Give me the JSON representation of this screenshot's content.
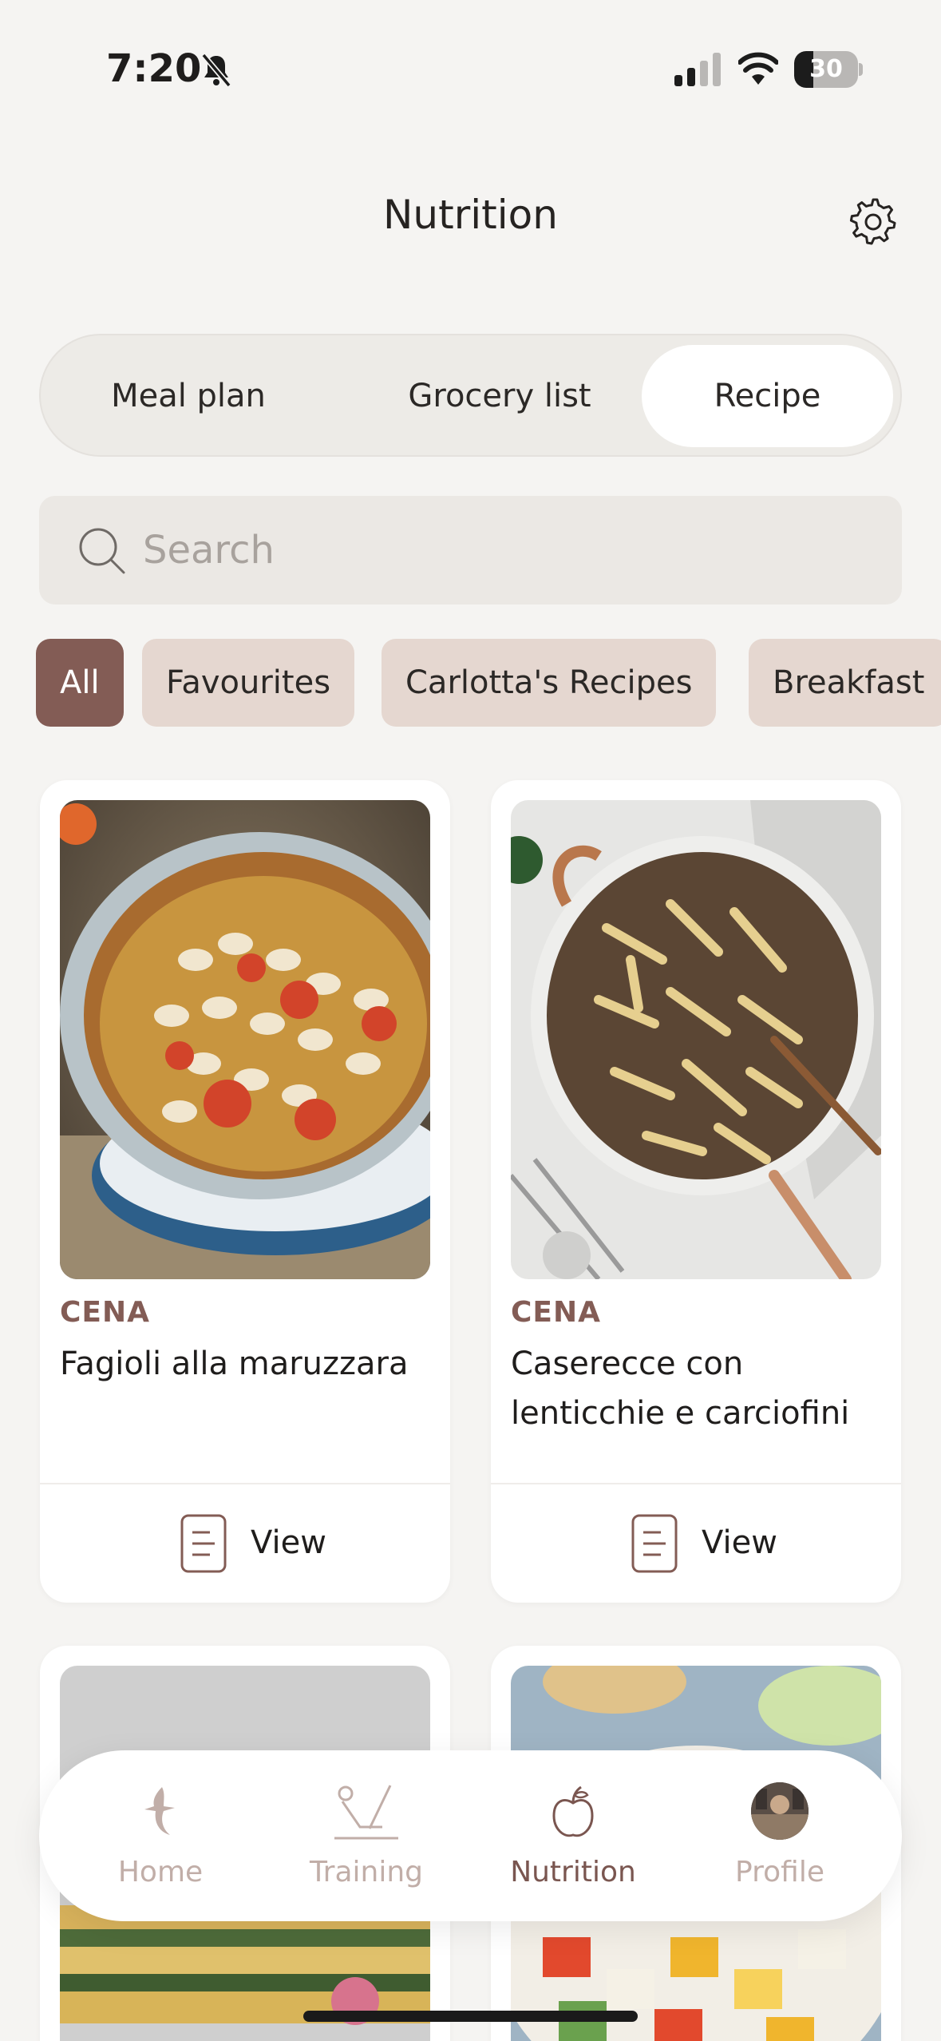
{
  "status_bar": {
    "time": "7:20",
    "battery_percent": "30",
    "battery_level": 0.3
  },
  "header": {
    "title": "Nutrition",
    "settings_icon": "gear-icon"
  },
  "segments": {
    "items": [
      "Meal plan",
      "Grocery list",
      "Recipe"
    ],
    "selected": "Recipe"
  },
  "search": {
    "placeholder": "Search",
    "value": ""
  },
  "filters": {
    "items": [
      "All",
      "Favourites",
      "Carlotta's Recipes",
      "Breakfast"
    ],
    "selected": "All"
  },
  "recipes": [
    {
      "category": "CENA",
      "title": "Fagioli alla maruzzara",
      "action": "View"
    },
    {
      "category": "CENA",
      "title": "Caserecce con lenticchie e carciofini",
      "action": "View"
    }
  ],
  "bottom_nav": {
    "items": [
      {
        "label": "Home",
        "icon": "home-logo-icon"
      },
      {
        "label": "Training",
        "icon": "training-icon"
      },
      {
        "label": "Nutrition",
        "icon": "apple-icon"
      },
      {
        "label": "Profile",
        "icon": "avatar"
      }
    ],
    "selected": "Nutrition"
  },
  "colors": {
    "accent": "#835c55",
    "chip": "#e5d7d0",
    "background": "#f5f4f2",
    "nav_inactive": "#c1aea8"
  }
}
